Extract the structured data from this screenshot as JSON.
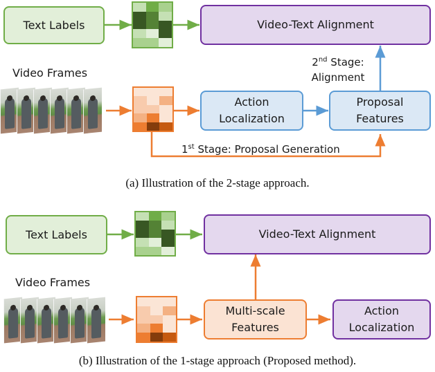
{
  "colors": {
    "green": "#70ad47",
    "green_fill": "#e2efd9",
    "purple": "#7030a0",
    "purple_fill": "#e4d8ee",
    "blue": "#5b9bd5",
    "blue_fill": "#dbe8f5",
    "orange": "#ed7d31",
    "orange_fill": "#fbe3d3"
  },
  "panel_a": {
    "text_labels": "Text Labels",
    "video_frames": "Video Frames",
    "video_text_alignment": "Video-Text Alignment",
    "action_localization_line1": "Action",
    "action_localization_line2": "Localization",
    "proposal_features_line1": "Proposal",
    "proposal_features_line2": "Features",
    "stage2_num": "2",
    "stage2_sup": "nd",
    "stage2_rest": " Stage:",
    "stage2_line2": "Alignment",
    "stage1_num": "1",
    "stage1_sup": "st",
    "stage1_rest": " Stage: Proposal Generation",
    "caption": "(a)  Illustration of the 2-stage approach.",
    "text_feature_grid": [
      "#c5e0b4",
      "#70ad47",
      "#a9d18e",
      "#385723",
      "#548235",
      "#c5e0b4",
      "#385723",
      "#548235",
      "#385723",
      "#c5e0b4",
      "#e2efd9",
      "#385723",
      "#a9d18e",
      "#a9d18e",
      "#e2efd9",
      "#a9d18e",
      "#548235",
      "#e2efd9"
    ],
    "video_feature_grid": [
      "#fbe5d6",
      "#fbe5d6",
      "#fbe5d6",
      "#f8cbad",
      "#fbe5d6",
      "#f4b183",
      "#f8cbad",
      "#f8cbad",
      "#fbe5d6",
      "#f4b183",
      "#ed7d31",
      "#fbe5d6",
      "#ed7d31",
      "#843c0c",
      "#c55a11",
      "#c55a11",
      "#843c0c",
      "#c55a11"
    ]
  },
  "panel_b": {
    "text_labels": "Text Labels",
    "video_frames": "Video Frames",
    "video_text_alignment": "Video-Text Alignment",
    "multiscale_line1": "Multi-scale",
    "multiscale_line2": "Features",
    "action_localization_line1": "Action",
    "action_localization_line2": "Localization",
    "caption": "(b)  Illustration of the 1-stage approach (Proposed method).",
    "text_feature_grid": [
      "#c5e0b4",
      "#70ad47",
      "#a9d18e",
      "#385723",
      "#548235",
      "#c5e0b4",
      "#385723",
      "#548235",
      "#385723",
      "#c5e0b4",
      "#e2efd9",
      "#385723",
      "#a9d18e",
      "#a9d18e",
      "#e2efd9",
      "#a9d18e",
      "#548235",
      "#e2efd9"
    ],
    "video_feature_grid": [
      "#fbe5d6",
      "#fbe5d6",
      "#fbe5d6",
      "#f8cbad",
      "#fbe5d6",
      "#f4b183",
      "#f8cbad",
      "#f8cbad",
      "#fbe5d6",
      "#f4b183",
      "#ed7d31",
      "#fbe5d6",
      "#ed7d31",
      "#843c0c",
      "#c55a11",
      "#c55a11",
      "#843c0c",
      "#c55a11"
    ]
  }
}
